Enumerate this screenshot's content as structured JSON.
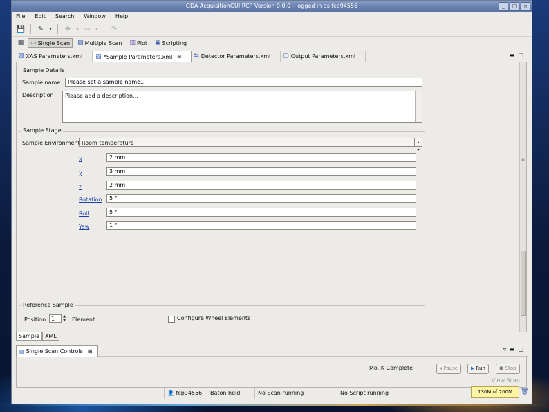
{
  "window": {
    "title": "GDA AcquisitionGUI RCP Version 0.0.0 - logged in as fcp94556"
  },
  "menu": [
    "File",
    "Edit",
    "Search",
    "Window",
    "Help"
  ],
  "perspectives": {
    "single_scan": "Single Scan",
    "multiple_scan": "Multiple Scan",
    "plot": "Plot",
    "scripting": "Scripting"
  },
  "editor_tabs": [
    {
      "label": "XAS Parameters.xml",
      "active": false
    },
    {
      "label": "*Sample Parameters.xml",
      "active": true
    },
    {
      "label": "Detector Parameters.xml",
      "active": false
    },
    {
      "label": "Output Parameters.xml",
      "active": false
    }
  ],
  "sample_details": {
    "group_title": "Sample Details",
    "name_label": "Sample name",
    "name_value": "Please set a sample name...",
    "description_label": "Description",
    "description_value": "Please add a description..."
  },
  "sample_stage": {
    "group_title": "Sample Stage",
    "environment_label": "Sample Environment",
    "environment_value": "Room temperature",
    "fields": [
      {
        "label": "x",
        "value": "2 mm"
      },
      {
        "label": "y",
        "value": "3 mm"
      },
      {
        "label": "z",
        "value": "2 mm"
      },
      {
        "label": "Rotation",
        "value": "5 °"
      },
      {
        "label": "Roll",
        "value": "5 °"
      },
      {
        "label": "Yaw",
        "value": "1 °"
      }
    ]
  },
  "reference_sample": {
    "group_title": "Reference Sample",
    "position_label": "Position",
    "position_value": "1",
    "element_label": "Element",
    "configure_label": "Configure Wheel Elements"
  },
  "bottom_tabs": {
    "sample": "Sample",
    "xml": "XML"
  },
  "single_scan_controls": {
    "view_title": "Single Scan Controls",
    "status_text": "Mo. K Complete",
    "pause_label": "Pause",
    "run_label": "Run",
    "stop_label": "Stop",
    "view_scan_label": "View Scan"
  },
  "status_bar": {
    "user": "fcp94556",
    "baton": "Baton held",
    "scan_status": "No Scan running",
    "script_status": "No Script running",
    "memory": "130M of 200M"
  },
  "colors": {
    "title_bar": "#6a82b0",
    "window_bg": "#ecebe8",
    "link_blue": "#1f3fa8",
    "memory_bg": "#fff3a5"
  }
}
